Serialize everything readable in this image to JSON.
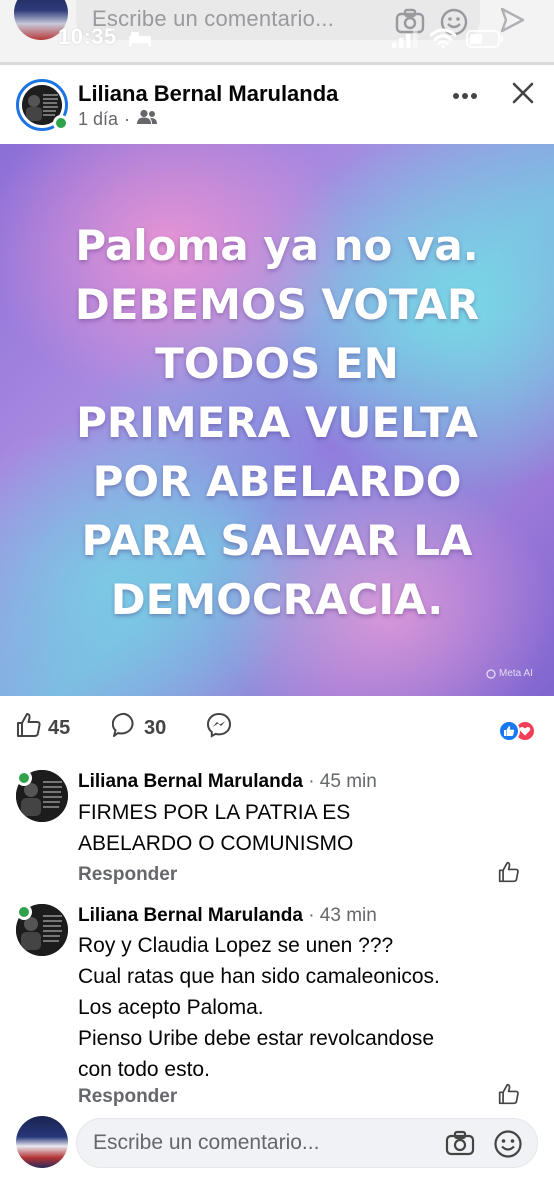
{
  "status_bar": {
    "time": "10:35"
  },
  "top_composer": {
    "placeholder": "Escribe un comentario..."
  },
  "post": {
    "author": "Liliana Bernal Marulanda",
    "time": "1 día",
    "separator": "·",
    "audience_icon": "friends-icon",
    "image_text_lines": [
      "Paloma ya no va.",
      "DEBEMOS VOTAR",
      "TODOS EN",
      "PRIMERA VUELTA",
      "POR ABELARDO",
      "PARA SALVAR LA",
      "DEMOCRACIA."
    ],
    "image_watermark": "Meta AI",
    "likes": "45",
    "comments": "30"
  },
  "comments": [
    {
      "author": "Liliana Bernal Marulanda",
      "time": "· 45 min",
      "lines": [
        "FIRMES POR LA PATRIA ES",
        "ABELARDO O COMUNISMO"
      ],
      "reply": "Responder"
    },
    {
      "author": "Liliana Bernal Marulanda",
      "time": "· 43 min",
      "lines": [
        "Roy y Claudia Lopez se unen ???",
        "Cual ratas que han sido camaleonicos.",
        "Los acepto Paloma.",
        "Pienso Uribe debe estar revolcandose",
        "con todo esto."
      ],
      "reply": "Responder"
    }
  ],
  "composer": {
    "placeholder": "Escribe un comentario..."
  },
  "colors": {
    "accent": "#1b74e4",
    "online": "#31a24c",
    "like": "#1877f2",
    "love": "#f33e58"
  }
}
